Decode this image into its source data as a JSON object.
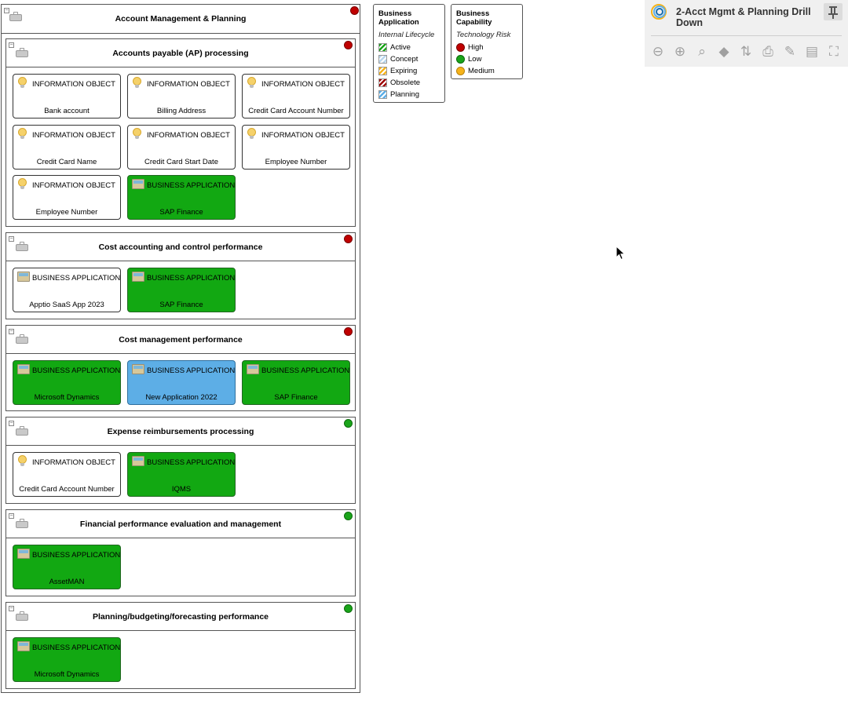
{
  "diagram": {
    "title": "Account Management & Planning",
    "risk": "red",
    "sections": [
      {
        "title": "Accounts payable (AP) processing",
        "risk": "red",
        "height": 240,
        "cards": [
          {
            "type": "INFORMATION OBJECT",
            "name": "Bank account",
            "style": "white",
            "icon": "bulb"
          },
          {
            "type": "INFORMATION OBJECT",
            "name": "Billing Address",
            "style": "white",
            "icon": "bulb"
          },
          {
            "type": "INFORMATION OBJECT",
            "name": "Credit Card Account Number",
            "style": "white",
            "icon": "bulb"
          },
          {
            "type": "INFORMATION OBJECT",
            "name": "Credit Card Name",
            "style": "white",
            "icon": "bulb"
          },
          {
            "type": "INFORMATION OBJECT",
            "name": "Credit Card Start Date",
            "style": "white",
            "icon": "bulb"
          },
          {
            "type": "INFORMATION OBJECT",
            "name": "Employee Number",
            "style": "white",
            "icon": "bulb"
          },
          {
            "type": "INFORMATION OBJECT",
            "name": "Employee Number",
            "style": "white",
            "icon": "bulb"
          },
          {
            "type": "BUSINESS APPLICATION",
            "name": "SAP Finance",
            "style": "green",
            "icon": "app"
          }
        ]
      },
      {
        "title": "Cost accounting and control performance",
        "risk": "red",
        "height": 111,
        "cards": [
          {
            "type": "BUSINESS APPLICATION",
            "name": "Apptio SaaS App 2023",
            "style": "white",
            "icon": "app"
          },
          {
            "type": "BUSINESS APPLICATION",
            "name": "SAP Finance",
            "style": "green",
            "icon": "app"
          }
        ]
      },
      {
        "title": "Cost management performance",
        "risk": "red",
        "height": 110,
        "cards": [
          {
            "type": "BUSINESS APPLICATION",
            "name": "Microsoft Dynamics",
            "style": "green",
            "icon": "app"
          },
          {
            "type": "BUSINESS APPLICATION",
            "name": "New Application 2022",
            "style": "blue",
            "icon": "app"
          },
          {
            "type": "BUSINESS APPLICATION",
            "name": "SAP Finance",
            "style": "green",
            "icon": "app"
          }
        ]
      },
      {
        "title": "Expense reimbursements processing",
        "risk": "green",
        "height": 111,
        "cards": [
          {
            "type": "INFORMATION OBJECT",
            "name": "Credit Card Account Number",
            "style": "white",
            "icon": "bulb"
          },
          {
            "type": "BUSINESS APPLICATION",
            "name": "IQMS",
            "style": "green",
            "icon": "app"
          }
        ]
      },
      {
        "title": "Financial performance evaluation and management",
        "risk": "green",
        "height": 111,
        "cards": [
          {
            "type": "BUSINESS APPLICATION",
            "name": "AssetMAN",
            "style": "green",
            "icon": "app"
          }
        ]
      },
      {
        "title": "Planning/budgeting/forecasting performance",
        "risk": "green",
        "height": 111,
        "cards": [
          {
            "type": "BUSINESS APPLICATION",
            "name": "Microsoft Dynamics",
            "style": "green",
            "icon": "app"
          }
        ]
      }
    ]
  },
  "legend_app": {
    "title": "Business Application",
    "subtitle": "Internal Lifecycle",
    "items": [
      {
        "label": "Active",
        "color": "#1aa41a"
      },
      {
        "label": "Concept",
        "color": "#b9d7ee"
      },
      {
        "label": "Expiring",
        "color": "#f6b31a"
      },
      {
        "label": "Obsolete",
        "color": "#9e0000"
      },
      {
        "label": "Planning",
        "color": "#5daee6"
      }
    ]
  },
  "legend_cap": {
    "title": "Business Capability",
    "subtitle": "Technology Risk",
    "items": [
      {
        "label": "High",
        "color": "red"
      },
      {
        "label": "Low",
        "color": "green"
      },
      {
        "label": "Medium",
        "color": "orange"
      }
    ]
  },
  "panel": {
    "title": "2-Acct Mgmt & Planning Drill Down",
    "toolbar": [
      {
        "name": "zoom-out-icon",
        "glyph": "⊖"
      },
      {
        "name": "zoom-in-icon",
        "glyph": "⊕"
      },
      {
        "name": "zoom-fit-icon",
        "glyph": "⌕"
      },
      {
        "name": "layers-icon",
        "glyph": "◆"
      },
      {
        "name": "sort-icon",
        "glyph": "⇅"
      },
      {
        "name": "print-icon",
        "glyph": "⎙"
      },
      {
        "name": "draw-icon",
        "glyph": "✎"
      },
      {
        "name": "comment-icon",
        "glyph": "▤"
      },
      {
        "name": "fullscreen-icon",
        "glyph": "⛶"
      }
    ]
  }
}
